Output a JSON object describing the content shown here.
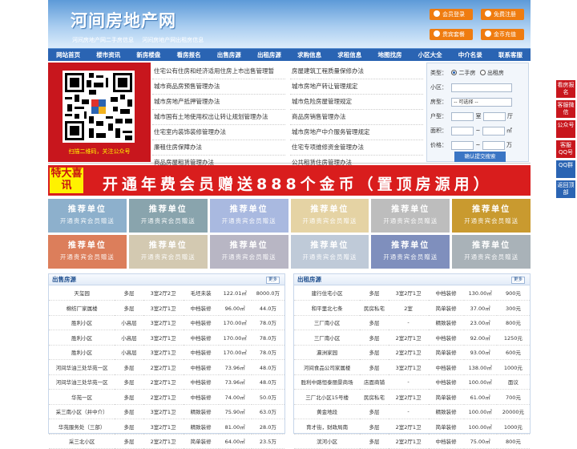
{
  "header": {
    "title": "河间房地产网",
    "subtitles": [
      "河间房地产网二手房信息",
      "河间房地产网出租房信息"
    ],
    "buttons": [
      "会员登录",
      "免费注册",
      "贵宾套餐",
      "金币充值"
    ]
  },
  "nav": [
    "网站首页",
    "楼市资讯",
    "新房楼盘",
    "看房报名",
    "出售房源",
    "出租房源",
    "求购信息",
    "求租信息",
    "地图找房",
    "小区大全",
    "中介名录",
    "联系客服"
  ],
  "qr_caption": "扫描二维码，关注公众号",
  "news_left": [
    "住宅公有住房和经济适用住房上市出售管理暂",
    "城市商品房预售管理办法",
    "城市房地产抵押管理办法",
    "城市国有土地使用权出让转让规划管理办法",
    "住宅室内装饰装修管理办法",
    "廉租住房保障办法",
    "商品房屋租赁管理办法"
  ],
  "news_right": [
    "房屋建筑工程质量保修办法",
    "城市房地产转让管理规定",
    "城市危险房屋管理规定",
    "商品房销售管理办法",
    "城市房地产中介服务管理规定",
    "住宅专项维修资金管理办法",
    "公共租赁住房管理办法"
  ],
  "search": {
    "type_label": "类型：",
    "opt1": "二手房",
    "opt2": "出租房",
    "area_label": "小区：",
    "house_label": "房型：",
    "house_select": "-- 可选择 --",
    "layout_label": "户型：",
    "room": "室",
    "hall": "厅",
    "size_label": "面积：",
    "to": "~",
    "unit_area": "㎡",
    "price_label": "价格：",
    "unit_price": "万",
    "submit": "确认提交搜索"
  },
  "banner": {
    "tag": "特大喜讯",
    "text": "开通年费会员赠送888个金币（置顶房源用）"
  },
  "ads": {
    "title": "推荐单位",
    "sub": "开通贵宾会员赠送",
    "colors": [
      "#8db0cc",
      "#89a4ad",
      "#a9b9e0",
      "#e5d3a4",
      "#bdbdbd",
      "#c99a2f",
      "#dc7e5b",
      "#d3c9b1",
      "#b8b6c4",
      "#bfcad8",
      "#7f8fbd",
      "#a9b2b8"
    ]
  },
  "sale": {
    "title": "出售房源",
    "more": "更多",
    "rows": [
      [
        "天玺园",
        "多层",
        "3室2厅2卫",
        "毛坯未装",
        "122.01㎡",
        "8000.0万"
      ],
      [
        "棉纺厂家属楼",
        "多层",
        "3室2厅1卫",
        "中档装修",
        "96.00㎡",
        "44.0万"
      ],
      [
        "胜利小区",
        "小高层",
        "3室2厅1卫",
        "中档装修",
        "170.00㎡",
        "78.0万"
      ],
      [
        "胜利小区",
        "小高层",
        "3室2厅1卫",
        "中档装修",
        "170.00㎡",
        "78.0万"
      ],
      [
        "胜利小区",
        "小高层",
        "3室2厅1卫",
        "中档装修",
        "170.00㎡",
        "78.0万"
      ],
      [
        "河间华油三处华苑一区",
        "多层",
        "2室2厅1卫",
        "中档装修",
        "73.96㎡",
        "48.0万"
      ],
      [
        "河间华油三处华苑一区",
        "多层",
        "2室2厅1卫",
        "中档装修",
        "73.96㎡",
        "48.0万"
      ],
      [
        "华苑一区",
        "多层",
        "2室2厅1卫",
        "中档装修",
        "74.00㎡",
        "50.0万"
      ],
      [
        "采三南小区（井中介）",
        "多层",
        "3室2厅1卫",
        "精致装修",
        "75.90㎡",
        "63.0万"
      ],
      [
        "华苑服务处（三部）",
        "多层",
        "3室2厅1卫",
        "精致装修",
        "81.00㎡",
        "28.0万"
      ],
      [
        "采三北小区",
        "多层",
        "2室2厅1卫",
        "简单装修",
        "64.00㎡",
        "23.5万"
      ]
    ]
  },
  "rent": {
    "title": "出租房源",
    "more": "更多",
    "rows": [
      [
        "建行住宅小区",
        "多层",
        "3室2厅1卫",
        "中档装修",
        "130.00㎡",
        "900元"
      ],
      [
        "和平里北七条",
        "民房私宅",
        "2室",
        "简单装修",
        "37.00㎡",
        "300元"
      ],
      [
        "三厂南小区",
        "多层",
        "-",
        "精致装修",
        "23.00㎡",
        "800元"
      ],
      [
        "三厂南小区",
        "多层",
        "2室2厅1卫",
        "中档装修",
        "92.00㎡",
        "1250元"
      ],
      [
        "瀛洲家园",
        "多层",
        "2室2厅1卫",
        "简单装修",
        "93.00㎡",
        "600元"
      ],
      [
        "河间食品公司家属楼",
        "多层",
        "3室2厅1卫",
        "中档装修",
        "138.00㎡",
        "1000元"
      ],
      [
        "胜利中路恒泰丽景商场",
        "店面商铺",
        "-",
        "中档装修",
        "100.00㎡",
        "面议"
      ],
      [
        "三厂北小区15号楼",
        "民房私宅",
        "2室2厅1卫",
        "简单装修",
        "61.00㎡",
        "700元"
      ],
      [
        "黄金地段",
        "多层",
        "-",
        "精致装修",
        "100.00㎡",
        "20000元"
      ],
      [
        "育才街，财政局南",
        "多层",
        "2室2厅1卫",
        "简单装修",
        "100.00㎡",
        "1000元"
      ],
      [
        "滨河小区",
        "多层",
        "2室2厅1卫",
        "中档装修",
        "75.00㎡",
        "800元"
      ]
    ]
  },
  "side": [
    "看房报名",
    "客服微信",
    "公众号",
    "客服QQ号",
    "QQ群",
    "返回顶部"
  ]
}
